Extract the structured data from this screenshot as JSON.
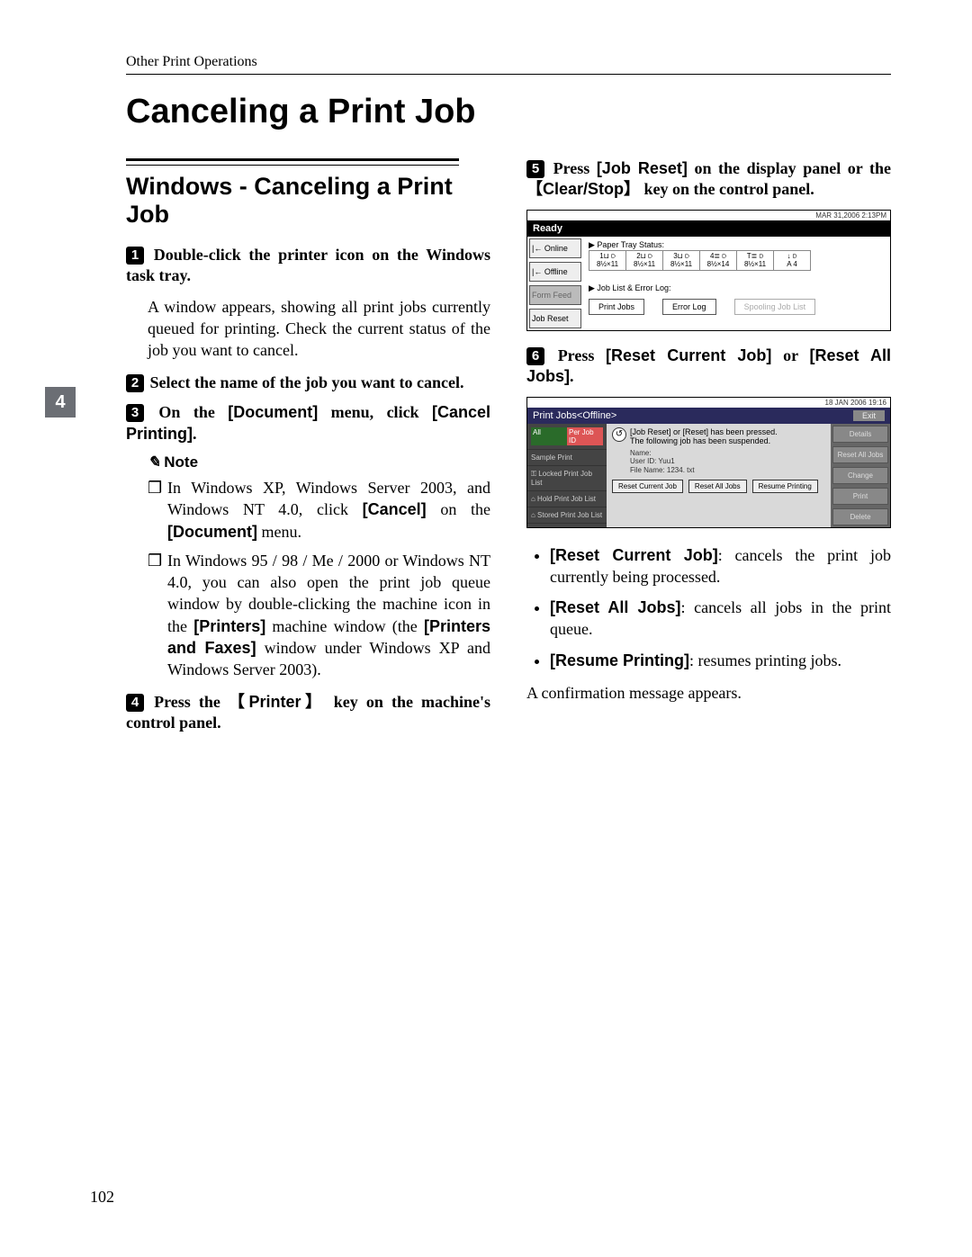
{
  "running_head": "Other Print Operations",
  "title": "Canceling a Print Job",
  "side_tab": "4",
  "folio": "102",
  "left": {
    "section_heading": "Windows - Canceling a Print Job",
    "step1_num": "1",
    "step1": "Double-click the printer icon on the Windows task tray.",
    "step1_body": "A window appears, showing all print jobs currently queued for printing. Check the current status of the job you want to cancel.",
    "step2_num": "2",
    "step2": "Select the name of the job you want to cancel.",
    "step3_num": "3",
    "step3_pre": "On the ",
    "step3_doc": "[Document]",
    "step3_mid": " menu, click ",
    "step3_cp": "[Cancel Printing]",
    "step3_post": ".",
    "note_label": "Note",
    "note_a_pre": "In Windows XP, Windows Server 2003, and Windows NT 4.0, click ",
    "note_a_cancel": "[Cancel]",
    "note_a_mid": " on the ",
    "note_a_doc": "[Document]",
    "note_a_post": " menu.",
    "note_b_pre": "In Windows 95 / 98 / Me / 2000 or Windows NT 4.0, you can also open the print job queue window by double-clicking the machine icon in the ",
    "note_b_printers": "[Printers]",
    "note_b_mid": " machine window (the ",
    "note_b_pf": "[Printers and Faxes]",
    "note_b_post": " window under Windows XP and Windows Server 2003).",
    "step4_num": "4",
    "step4_pre": "Press the ",
    "step4_key": "Printer",
    "step4_post": " key on the machine's control panel."
  },
  "right": {
    "step5_num": "5",
    "step5_pre": "Press ",
    "step5_jobreset": "[Job Reset]",
    "step5_mid": " on the display panel or the ",
    "step5_key": "Clear/Stop",
    "step5_post": " key on the control panel.",
    "step6_num": "6",
    "step6_pre": "Press ",
    "step6_rcj": "[Reset Current Job]",
    "step6_mid": " or ",
    "step6_raj": "[Reset All Jobs]",
    "step6_post": ".",
    "b1_lead": "[Reset Current Job]",
    "b1_text": ": cancels the print job currently being processed.",
    "b2_lead": "[Reset All Jobs]",
    "b2_text": ": cancels all jobs in the print queue.",
    "b3_lead": "[Resume Printing]",
    "b3_text": ": resumes printing jobs.",
    "confirm": "A confirmation message appears."
  },
  "mock1": {
    "date": "MAR   31,2006   2:13PM",
    "ready": "Ready",
    "online": "|← Online",
    "offline": "|← Offline",
    "formfeed": "Form Feed",
    "jobreset": "Job Reset",
    "paper_tray_label": "Paper Tray Status:",
    "trays": [
      {
        "t": "1⊔ ⫐",
        "b": "8½×11"
      },
      {
        "t": "2⊔ ⫐",
        "b": "8½×11"
      },
      {
        "t": "3⊔ ⫐",
        "b": "8½×11"
      },
      {
        "t": "4≣ ⫐",
        "b": "8½×14"
      },
      {
        "t": "T≣ ⫐",
        "b": "8½×11"
      },
      {
        "t": "↓ ⫐",
        "b": "A 4"
      }
    ],
    "joblist_label": "Job List & Error Log:",
    "print_jobs": "Print Jobs",
    "error_log": "Error Log",
    "spooling": "Spooling Job List"
  },
  "mock2": {
    "date": "18 JAN  2006 19:16",
    "title": "Print Jobs<Offline>",
    "exit": "Exit",
    "tab_all": "All",
    "tab_perjob": "Per Job ID",
    "litem1": "Sample Print",
    "litem2": "⚿ Locked Print Job List",
    "litem3": "⌂ Hold Print Job List",
    "litem4": "⌂ Stored Print Job List",
    "msg1": "[Job Reset] or [Reset] has been pressed.",
    "msg2": "The following job has been suspended.",
    "det_name": "Name:",
    "det_user": "User ID:  Yuu1",
    "det_file": "File Name:  1234. txt",
    "btn_rcj": "Reset Current Job",
    "btn_raj": "Reset All Jobs",
    "btn_resume": "Resume Printing",
    "r_details": "Details",
    "r_resetall": "Reset All Jobs",
    "r_change": "Change",
    "r_print": "Print",
    "r_delete": "Delete"
  }
}
